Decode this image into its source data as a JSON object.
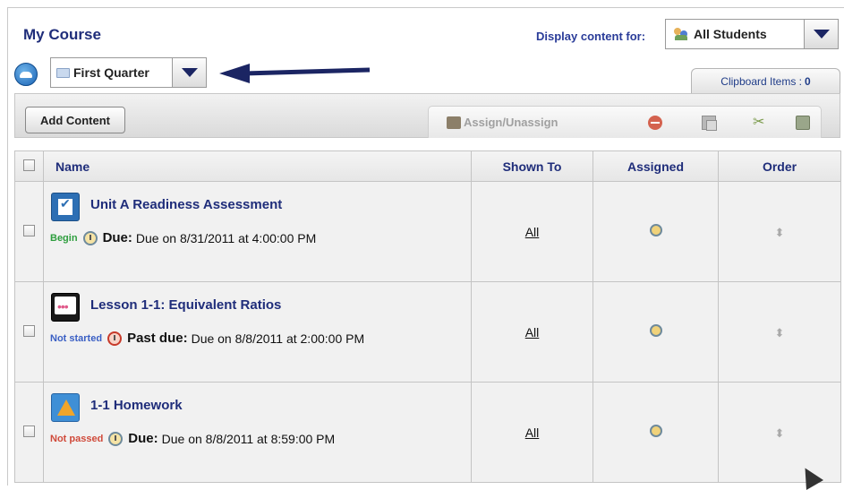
{
  "header": {
    "title": "My Course",
    "display_label": "Display content for:",
    "student_select": "All Students",
    "quarter_select": "First Quarter"
  },
  "clipboard": {
    "label": "Clipboard Items :",
    "count": "0"
  },
  "toolbar": {
    "add_content": "Add Content",
    "assign_unassign": "Assign/Unassign"
  },
  "table": {
    "columns": {
      "name": "Name",
      "shown_to": "Shown To",
      "assigned": "Assigned",
      "order": "Order"
    },
    "rows": [
      {
        "title": "Unit A Readiness Assessment",
        "status": "Begin",
        "due_label": "Due:",
        "due_text": "Due on 8/31/2011 at 4:00:00 PM",
        "shown_to": "All"
      },
      {
        "title": "Lesson 1-1: Equivalent Ratios",
        "status": "Not started",
        "due_label": "Past due:",
        "due_text": "Due on 8/8/2011 at 2:00:00 PM",
        "shown_to": "All"
      },
      {
        "title": "1-1 Homework",
        "status": "Not passed",
        "due_label": "Due:",
        "due_text": "Due on 8/8/2011 at 8:59:00 PM",
        "shown_to": "All"
      }
    ]
  },
  "colors": {
    "title_blue": "#1f2d7a",
    "status_begin": "#2e9e3e",
    "status_not_started": "#3a5fc4",
    "status_not_passed": "#d04a3a",
    "annotation_arrow": "#1b2563"
  },
  "icons": {
    "back": "circle-back-icon",
    "student_group": "students-icon",
    "folder": "folder-icon",
    "assign": "pencil-assign-icon",
    "delete": "delete-icon",
    "copy": "copy-icon",
    "cut": "scissors-icon",
    "paste": "paste-icon",
    "due": "alarm-clock-icon",
    "order": "updown-arrows-icon"
  }
}
